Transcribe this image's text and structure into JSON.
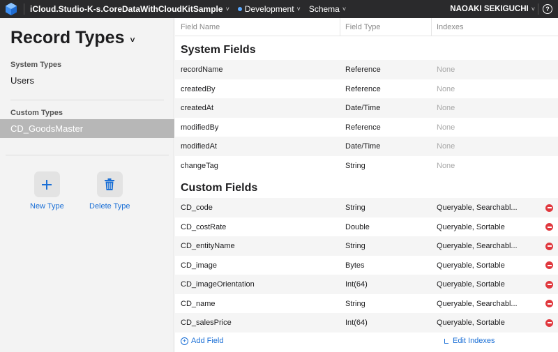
{
  "topbar": {
    "container": "iCloud.Studio-K-s.CoreDataWithCloudKitSample",
    "environment": "Development",
    "schema": "Schema",
    "user": "NAOAKI SEKIGUCHI",
    "help": "?",
    "chevron": "˅"
  },
  "sidebar": {
    "title": "Record Types",
    "title_chevron": "˅",
    "system_types_label": "System Types",
    "system_types": [
      "Users"
    ],
    "custom_types_label": "Custom Types",
    "custom_types": [
      "CD_GoodsMaster"
    ],
    "new_type": "New Type",
    "delete_type": "Delete Type"
  },
  "table": {
    "headers": {
      "field_name": "Field Name",
      "field_type": "Field Type",
      "indexes": "Indexes"
    },
    "system_title": "System Fields",
    "system_fields": [
      {
        "name": "recordName",
        "type": "Reference",
        "indexes": "None"
      },
      {
        "name": "createdBy",
        "type": "Reference",
        "indexes": "None"
      },
      {
        "name": "createdAt",
        "type": "Date/Time",
        "indexes": "None"
      },
      {
        "name": "modifiedBy",
        "type": "Reference",
        "indexes": "None"
      },
      {
        "name": "modifiedAt",
        "type": "Date/Time",
        "indexes": "None"
      },
      {
        "name": "changeTag",
        "type": "String",
        "indexes": "None"
      }
    ],
    "custom_title": "Custom Fields",
    "custom_fields": [
      {
        "name": "CD_code",
        "type": "String",
        "indexes": "Queryable, Searchabl..."
      },
      {
        "name": "CD_costRate",
        "type": "Double",
        "indexes": "Queryable, Sortable"
      },
      {
        "name": "CD_entityName",
        "type": "String",
        "indexes": "Queryable, Searchabl..."
      },
      {
        "name": "CD_image",
        "type": "Bytes",
        "indexes": "Queryable, Sortable"
      },
      {
        "name": "CD_imageOrientation",
        "type": "Int(64)",
        "indexes": "Queryable, Sortable"
      },
      {
        "name": "CD_name",
        "type": "String",
        "indexes": "Queryable, Searchabl..."
      },
      {
        "name": "CD_salesPrice",
        "type": "Int(64)",
        "indexes": "Queryable, Sortable"
      }
    ],
    "add_field": "Add Field",
    "edit_indexes": "Edit Indexes",
    "plus": "+"
  },
  "colors": {
    "accent": "#1a6fd6",
    "delete": "#e0383e",
    "selected": "#b7b7b7"
  }
}
